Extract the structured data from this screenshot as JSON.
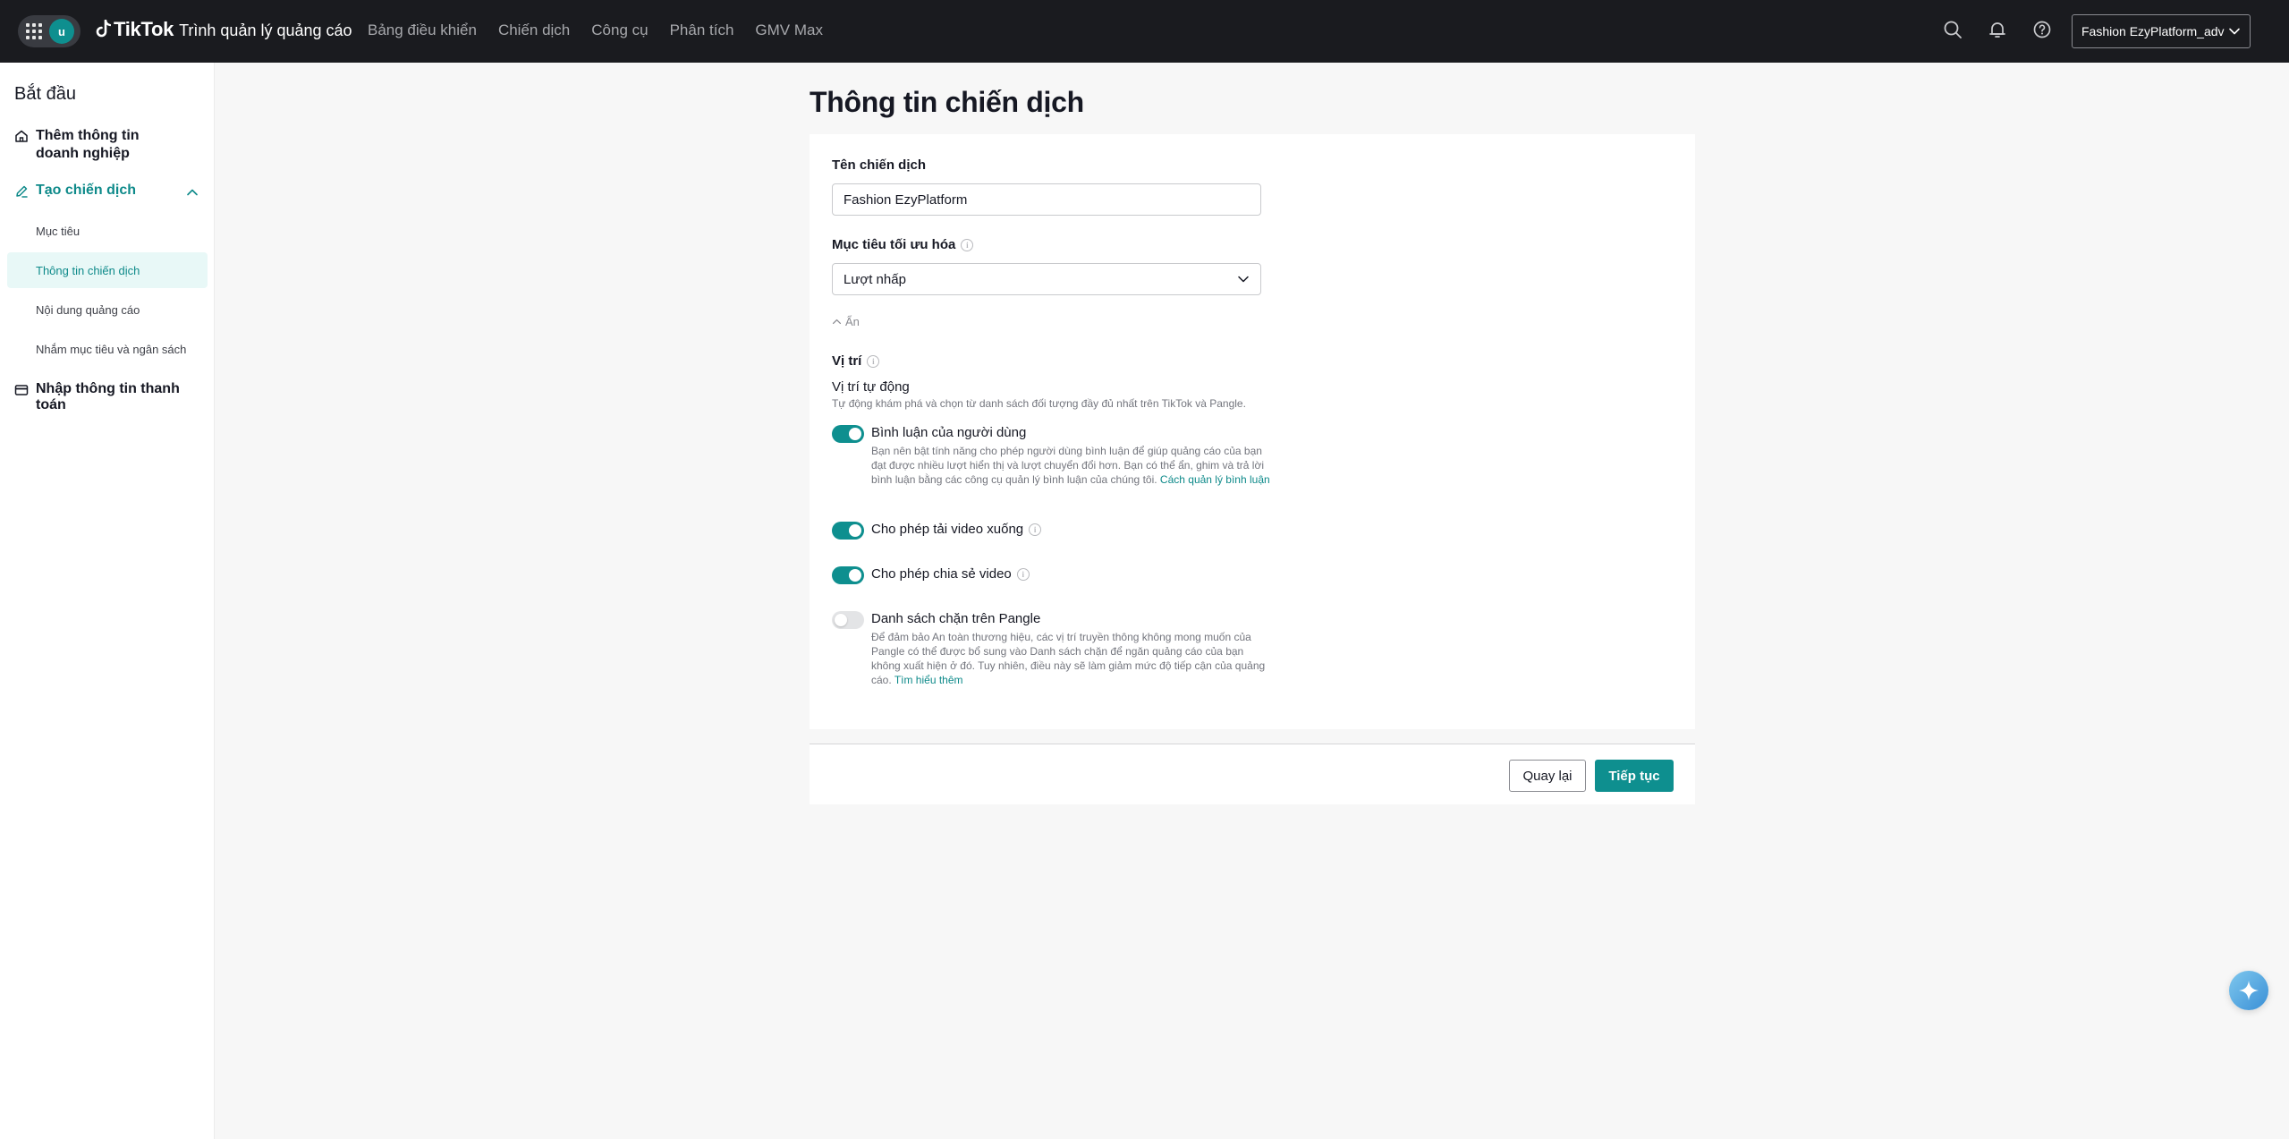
{
  "app": {
    "avatar_letter": "u",
    "brand_name": "TikTok",
    "brand_sub": "Trình quản lý quảng cáo"
  },
  "topnav": [
    {
      "label": "Bảng điều khiển"
    },
    {
      "label": "Chiến dịch"
    },
    {
      "label": "Công cụ"
    },
    {
      "label": "Phân tích"
    },
    {
      "label": "GMV Max"
    }
  ],
  "account": {
    "name": "Fashion EzyPlatform_adv"
  },
  "sidebar": {
    "title": "Bắt đầu",
    "business_info": "Thêm thông tin doanh nghiệp",
    "create_campaign": "Tạo chiến dịch",
    "sub_items": [
      {
        "label": "Mục tiêu"
      },
      {
        "label": "Thông tin chiến dịch"
      },
      {
        "label": "Nội dung quảng cáo"
      },
      {
        "label": "Nhắm mục tiêu và ngân sách"
      }
    ],
    "payment": "Nhập thông tin thanh toán"
  },
  "main": {
    "page_title": "Thông tin chiến dịch",
    "campaign_name_label": "Tên chiến dịch",
    "campaign_name_value": "Fashion EzyPlatform",
    "optimization_label": "Mục tiêu tối ưu hóa",
    "optimization_value": "Lượt nhấp",
    "hide_label": "Ẩn",
    "placement_label": "Vị trí",
    "auto_placement_title": "Vị trí tự động",
    "auto_placement_desc": "Tự động khám phá và chọn từ danh sách đối tượng đầy đủ nhất trên TikTok và Pangle.",
    "toggles": [
      {
        "label": "Bình luận của người dùng",
        "on": true,
        "desc": "Bạn nên bật tính năng cho phép người dùng bình luận để giúp quảng cáo của bạn đạt được nhiều lượt hiển thị và lượt chuyển đổi hơn. Bạn có thể ẩn, ghim và trả lời bình luận bằng các công cụ quản lý bình luận của chúng tôi.",
        "link": "Cách quản lý bình luận"
      },
      {
        "label": "Cho phép tải video xuống",
        "on": true
      },
      {
        "label": "Cho phép chia sẻ video",
        "on": true
      },
      {
        "label": "Danh sách chặn trên Pangle",
        "on": false,
        "desc": "Để đảm bảo An toàn thương hiệu, các vị trí truyền thông không mong muốn của Pangle có thể được bổ sung vào Danh sách chặn để ngăn quảng cáo của bạn không xuất hiện ở đó. Tuy nhiên, điều này sẽ làm giảm mức độ tiếp cận của quảng cáo.",
        "link": "Tìm hiểu thêm"
      }
    ]
  },
  "footer": {
    "back_label": "Quay lại",
    "next_label": "Tiếp tục"
  },
  "colors": {
    "accent": "#0e8f8f",
    "topbar": "#1a1b1f"
  },
  "icons": [
    "apps-grid-icon",
    "tiktok-logo-icon",
    "search-icon",
    "bell-icon",
    "help-icon",
    "chevron-down-icon",
    "home-icon",
    "edit-icon",
    "chevron-up-icon",
    "card-icon",
    "info-icon",
    "sparkle-icon"
  ]
}
